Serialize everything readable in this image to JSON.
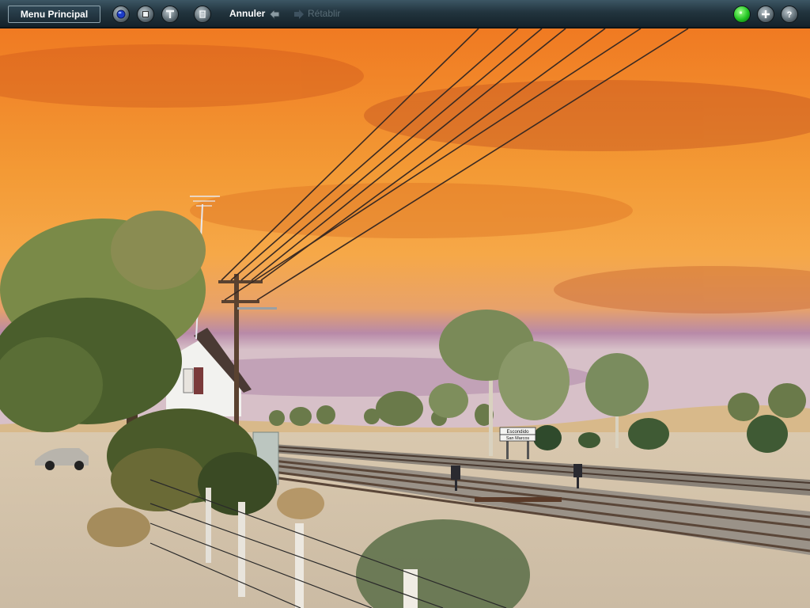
{
  "toolbar": {
    "menu_label": "Menu Principal",
    "undo_label": "Annuler",
    "redo_label": "Rétablir",
    "left_buttons": [
      "globe-icon",
      "stop-icon",
      "track-tool-icon",
      "delete-icon"
    ],
    "right_buttons": [
      "status-light-icon",
      "add-icon",
      "help-icon"
    ]
  },
  "scene": {
    "sign": {
      "line1": "Escondido",
      "line2": "San Marcos"
    }
  },
  "colors": {
    "toolbar_top": "#3c5664",
    "toolbar_bottom": "#14222a",
    "sky_orange": "#f08a2a",
    "sky_purple": "#b07aa0",
    "status_green": "#22c422"
  }
}
